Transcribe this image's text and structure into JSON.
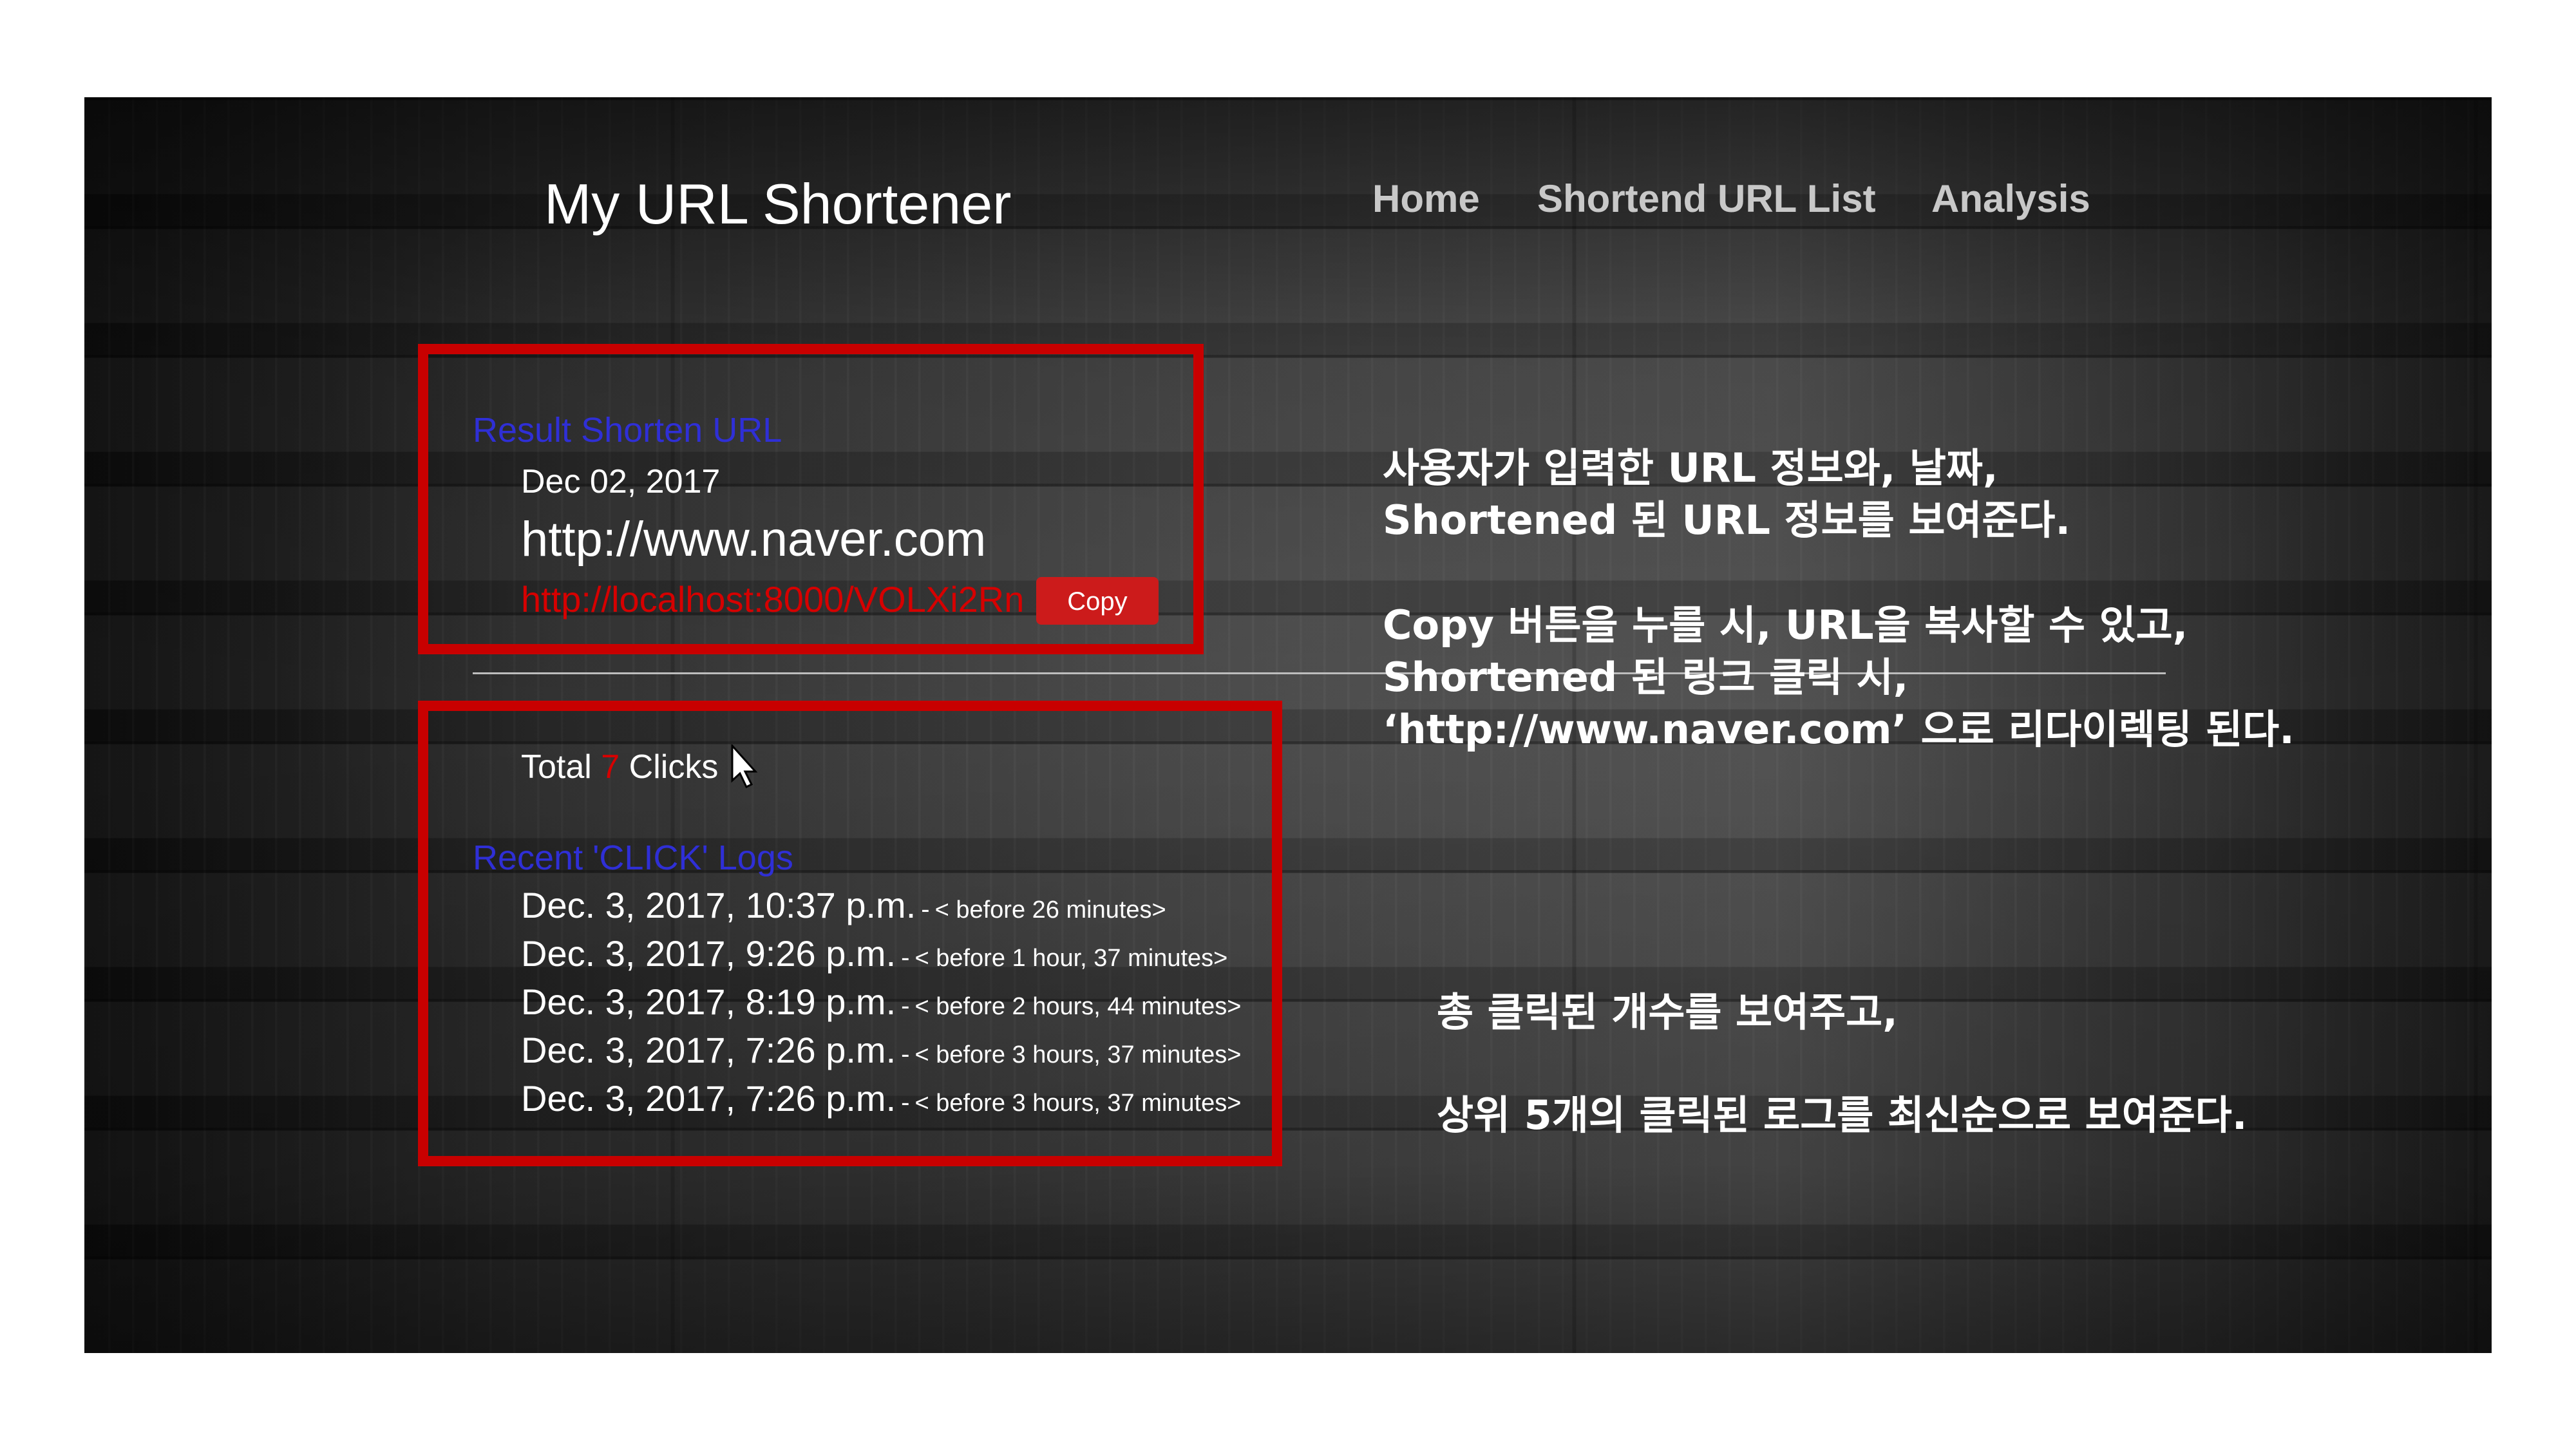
{
  "header": {
    "brand": "My URL Shortener",
    "nav": [
      "Home",
      "Shortend URL List",
      "Analysis"
    ]
  },
  "result": {
    "heading": "Result Shorten URL",
    "date": "Dec 02, 2017",
    "original_url": "http://www.naver.com",
    "short_url": "http://localhost:8000/VOLXi2Rn",
    "copy_label": "Copy"
  },
  "clicks": {
    "prefix": "Total",
    "count": "7",
    "suffix": "Clicks"
  },
  "logs": {
    "heading": "Recent 'CLICK' Logs",
    "separator": "-",
    "items": [
      {
        "time": "Dec. 3, 2017, 10:37 p.m.",
        "ago": "< before 26 minutes>"
      },
      {
        "time": "Dec. 3, 2017, 9:26 p.m.",
        "ago": "< before 1 hour, 37 minutes>"
      },
      {
        "time": "Dec. 3, 2017, 8:19 p.m.",
        "ago": "< before 2 hours, 44 minutes>"
      },
      {
        "time": "Dec. 3, 2017, 7:26 p.m.",
        "ago": "< before 3 hours, 37 minutes>"
      },
      {
        "time": "Dec. 3, 2017, 7:26 p.m.",
        "ago": "< before 3 hours, 37 minutes>"
      }
    ]
  },
  "annotations": {
    "top": [
      "사용자가 입력한 URL 정보와, 날짜,",
      "Shortened 된 URL 정보를 보여준다.",
      "Copy 버튼을 누를 시, URL을 복사할 수 있고,",
      "Shortened 된 링크 클릭 시,",
      "‘http://www.naver.com’ 으로 리다이렉팅 된다."
    ],
    "bottom": [
      "총 클릭된 개수를 보여주고,",
      "상위 5개의 클릭된 로그를 최신순으로 보여준다."
    ]
  },
  "colors": {
    "highlight_box": "#c80000",
    "link_blue": "#2f2fd6",
    "short_url_red": "#d60000",
    "copy_button": "#cc1b1b"
  },
  "icons": [
    "mouse-pointer-icon"
  ]
}
